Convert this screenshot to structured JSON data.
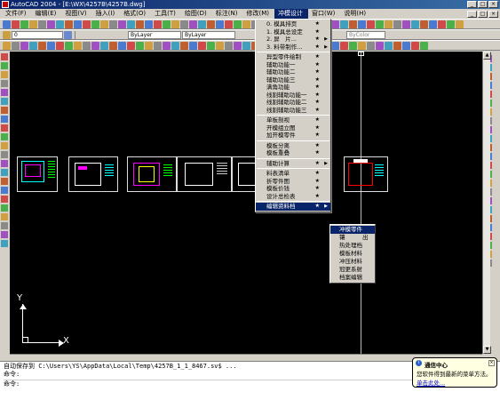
{
  "window": {
    "title": "AutoCAD 2004 - [E:\\WX\\4257B\\4257B.dwg]"
  },
  "menubar": {
    "items": [
      {
        "label": "文件(F)"
      },
      {
        "label": "编辑(E)"
      },
      {
        "label": "视图(V)"
      },
      {
        "label": "插入(I)"
      },
      {
        "label": "格式(O)"
      },
      {
        "label": "工具(T)"
      },
      {
        "label": "绘图(D)"
      },
      {
        "label": "标注(N)"
      },
      {
        "label": "修改(M)"
      },
      {
        "label": "冲模设计"
      },
      {
        "label": "窗口(W)"
      },
      {
        "label": "说明(H)"
      }
    ]
  },
  "toolbar": {
    "layer_value": "0",
    "color_value": "ByLayer",
    "linetype_value": "ByLayer",
    "lineweight_value": "ByColor"
  },
  "dropdown": {
    "items": [
      {
        "label": "0. 模具排页",
        "star": "★"
      },
      {
        "label": "1. 模具总设定",
        "star": "★"
      },
      {
        "label": "2. 屏　片...",
        "star": "★",
        "sub": true
      },
      {
        "label": "3. 料带制作...",
        "star": "★",
        "sub": true
      },
      {
        "sep": true
      },
      {
        "label": "异型零件绘制",
        "star": "★"
      },
      {
        "label": "辅助功能一",
        "star": "★"
      },
      {
        "label": "辅助功能二",
        "star": "★"
      },
      {
        "label": "辅助功能三",
        "star": "★"
      },
      {
        "label": "满角功能",
        "star": "★"
      },
      {
        "label": "线割辅助功能一",
        "star": "★"
      },
      {
        "label": "线割辅助功能二",
        "star": "★"
      },
      {
        "label": "线割辅助功能三",
        "star": "★"
      },
      {
        "sep": true
      },
      {
        "label": "单板剖视",
        "star": "★"
      },
      {
        "label": "开模组立图",
        "star": "★"
      },
      {
        "label": "加开模零件",
        "star": "★"
      },
      {
        "sep": true
      },
      {
        "label": "模板分离",
        "star": "★"
      },
      {
        "label": "模板重叠",
        "star": "★"
      },
      {
        "sep": true
      },
      {
        "label": "辅助计算",
        "star": "★",
        "sub": true
      },
      {
        "sep": true
      },
      {
        "label": "料表清单",
        "star": "★"
      },
      {
        "label": "折零件图",
        "star": "★"
      },
      {
        "label": "模板价钱",
        "star": "★"
      },
      {
        "label": "设计总检表",
        "star": "★"
      },
      {
        "sep": true
      },
      {
        "label": "编辑资料档",
        "star": "★",
        "sub": true,
        "selected": true
      }
    ]
  },
  "submenu": {
    "items": [
      {
        "label": "冲模零件",
        "selected": true
      },
      {
        "label": "镶　　　出"
      },
      {
        "label": "热处理档"
      },
      {
        "label": "模板材料"
      },
      {
        "label": "冲压材料"
      },
      {
        "label": "冠更系射"
      },
      {
        "label": "档案编辑"
      }
    ]
  },
  "ucs": {
    "y_label": "Y",
    "x_label": "X"
  },
  "command": {
    "line1": "自动保存到 C:\\Users\\YS\\AppData\\Local\\Temp\\4257B_1_1_8467.sv$ ...",
    "line2": "命令:",
    "line3": "命令:"
  },
  "balloon": {
    "title": "通信中心",
    "text": "您软件得到最新的菜单方法。",
    "link": "单击此处..."
  },
  "colors": {
    "accent": "#0a246a",
    "canvas": "#000000"
  }
}
